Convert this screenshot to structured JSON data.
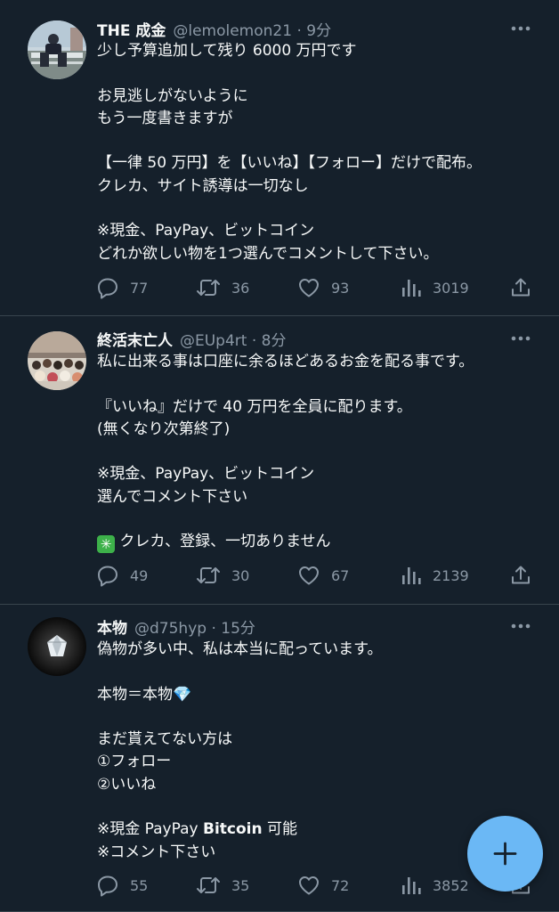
{
  "icons": {
    "reply": "reply-icon",
    "retweet": "retweet-icon",
    "like": "heart-icon",
    "views": "analytics-icon",
    "share": "share-icon",
    "more": "more-icon",
    "compose": "plus-icon"
  },
  "colors": {
    "background": "#15202b",
    "text": "#f7f9f9",
    "muted": "#8b98a5",
    "divider": "#38444d",
    "fab": "#6bb8f5"
  },
  "tweets": [
    {
      "name": "THE 成金",
      "handle": "@lemolemon21 · 9分",
      "lines": [
        "少し予算追加して残り 6000 万円です",
        "",
        "お見逃しがないように",
        "もう一度書きますが",
        "",
        "【一律 50 万円】を【いいね】【フォロー】だけで配布。",
        "クレカ、サイト誘導は一切なし",
        "",
        "※現金、PayPay、ビットコイン",
        "どれか欲しい物を1つ選んでコメントして下さい。"
      ],
      "replies": "77",
      "retweets": "36",
      "likes": "93",
      "views": "3019"
    },
    {
      "name": "終活末亡人",
      "handle": "@EUp4rt · 8分",
      "lines": [
        "私に出来る事は口座に余るほどあるお金を配る事です。",
        "",
        "『いいね』だけで 40 万円を全員に配ります。",
        "(無くなり次第終了)",
        "",
        "※現金、PayPay、ビットコイン",
        "選んでコメント下さい",
        "",
        "クレカ、登録、一切ありません"
      ],
      "last_line_emoji": "✳",
      "replies": "49",
      "retweets": "30",
      "likes": "67",
      "views": "2139"
    },
    {
      "name": "本物",
      "handle": "@d75hyp · 15分",
      "lines": [
        "偽物が多い中、私は本当に配っています。",
        "",
        "本物＝本物💎",
        "",
        "まだ貰えてない方は",
        "①フォロー",
        "②いいね",
        "",
        "※現金 PayPay ",
        "※コメント下さい"
      ],
      "bold_word": "Bitcoin",
      "bold_suffix": " 可能",
      "replies": "55",
      "retweets": "35",
      "likes": "72",
      "views": "3852"
    }
  ]
}
